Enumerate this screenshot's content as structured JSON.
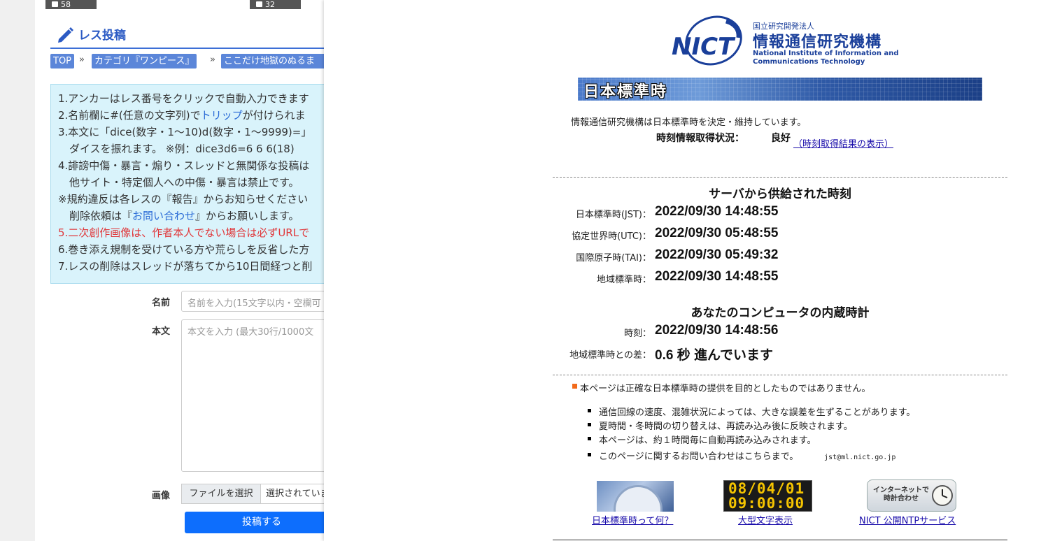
{
  "background_page": {
    "thumbnails": [
      {
        "count": "58"
      },
      {
        "count": "32"
      }
    ],
    "section_title": "レス投稿",
    "breadcrumbs": [
      "TOP",
      "カテゴリ『ワンピース』",
      "ここだけ地獄のぬるま"
    ],
    "breadcrumb_separator": "»",
    "rules": [
      "1.アンカーはレス番号をクリックで自動入力できます",
      "2.名前欄に#(任意の文字列)で",
      "トリップ",
      "が付けられま",
      "3.本文に「dice(数字・1〜10)d(数字・1〜9999)=」",
      "ダイスを振れます。 ※例：dice3d6=6 6 6(18)",
      "4.誹謗中傷・暴言・煽り・スレッドと無関係な投稿は",
      "他サイト・特定個人への中傷・暴言は禁止です。",
      "※規約違反は各レスの『報告』からお知らせください",
      "削除依頼は『",
      "お問い合わせ",
      "』からお願いします。",
      "5.二次創作画像は、作者本人でない場合は必ずURLで",
      "6.巻き添え規制を受けている方や荒らしを反省した方",
      "7.レスの削除はスレッドが落ちてから10日間経つと削"
    ],
    "form": {
      "name_label": "名前",
      "name_placeholder": "名前を入力(15文字以内・空欄可",
      "body_label": "本文",
      "body_placeholder": "本文を入力 (最大30行/1000文",
      "image_label": "画像",
      "file_button": "ファイルを選択",
      "file_status": "選択されていません",
      "submit": "投稿する"
    }
  },
  "nict": {
    "logo_text": "NICT",
    "org_type": "国立研究開発法人",
    "org_name": "情報通信研究機構",
    "org_en_1": "National Institute of Information and",
    "org_en_2": "Communications Technology",
    "banner": "日本標準時",
    "intro": "情報通信研究機構は日本標準時を決定・維持しています。",
    "status_label": "時刻情報取得状況：",
    "status_value": "良好",
    "status_link": "（時刻取得結果の表示）",
    "server_section": {
      "title": "サーバから供給された時刻",
      "rows": [
        {
          "label": "日本標準時(JST)：",
          "value": "2022/09/30 14:48:55"
        },
        {
          "label": "協定世界時(UTC)：",
          "value": "2022/09/30 05:48:55"
        },
        {
          "label": "国際原子時(TAI)：",
          "value": "2022/09/30 05:49:32"
        },
        {
          "label": "地域標準時：",
          "value": "2022/09/30 14:48:55"
        }
      ]
    },
    "local_section": {
      "title": "あなたのコンピュータの内蔵時計",
      "rows": [
        {
          "label": "時刻：",
          "value": "2022/09/30 14:48:56"
        },
        {
          "label": "地域標準時との差：",
          "value": "0.6 秒 進んでいます"
        }
      ]
    },
    "disclaimer": "本ページは正確な日本標準時の提供を目的としたものではありません。",
    "notes": [
      "通信回線の速度、混雑状況によっては、大きな誤差を生ずることがあります。",
      "夏時間・冬時間の切り替えは、再読み込み後に反映されます。",
      "本ページは、約１時間毎に自動再読み込みされます。",
      "このページに関するお問い合わせはこちらまで。"
    ],
    "contact_email": "jst@ml.nict.go.jp",
    "links": {
      "about_jst": "日本標準時って何？",
      "large_display": "大型文字表示",
      "ntp_service": "NICT 公開NTPサービス"
    },
    "led_date": "08/04/01",
    "led_time": "09:00:00",
    "ntp_image_text": "インターネットで時計合わせ",
    "colors": {
      "nict_blue": "#1a3f9a",
      "link_blue": "#1a0dab",
      "bullet_orange": "#f26a1b",
      "bg_accent": "#2c5bc4",
      "notice_bg": "#d9f3fb",
      "warning_red": "#e0383b"
    }
  }
}
